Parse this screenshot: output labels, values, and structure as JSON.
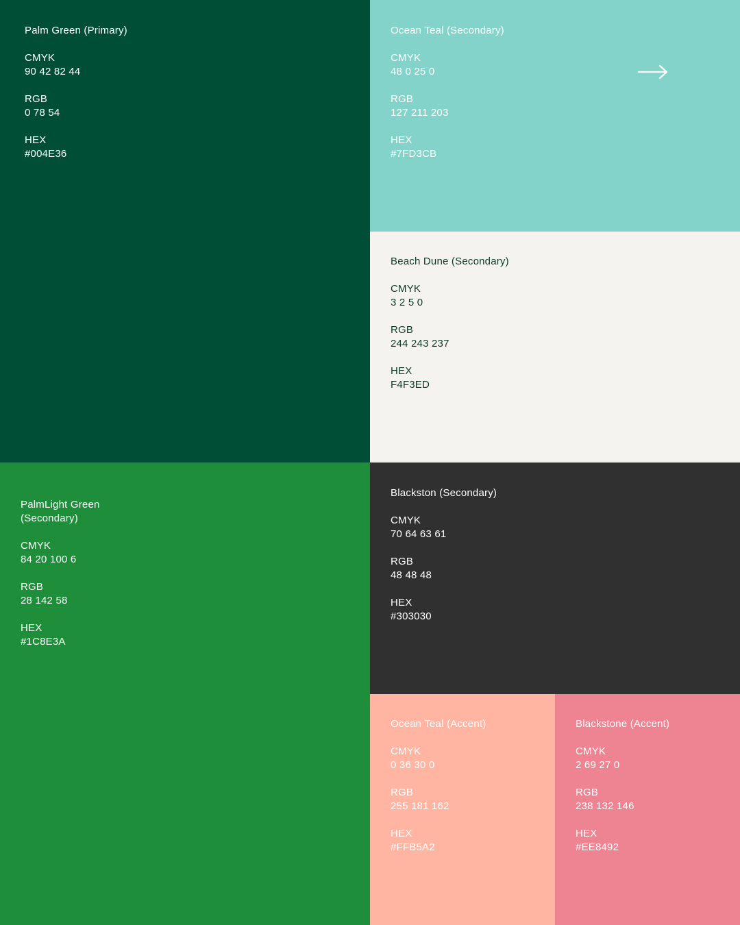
{
  "swatches": {
    "palm_green": {
      "title": "Palm Green (Primary)",
      "bg": "#004E36",
      "fg": "#FFFFFF",
      "cmyk_label": "CMYK",
      "cmyk": "90 42 82 44",
      "rgb_label": "RGB",
      "rgb": "0 78 54",
      "hex_label": "HEX",
      "hex": "#004E36"
    },
    "ocean_teal": {
      "title": "Ocean Teal (Secondary)",
      "bg": "#84D3CB",
      "fg": "#FFFFFF",
      "cmyk_label": "CMYK",
      "cmyk": "48 0 25 0",
      "rgb_label": "RGB",
      "rgb": "127 211 203",
      "hex_label": "HEX",
      "hex": "#7FD3CB"
    },
    "beach_dune": {
      "title": "Beach Dune (Secondary)",
      "bg": "#F4F3EF",
      "fg": "#0E3A24",
      "cmyk_label": "CMYK",
      "cmyk": "3 2 5 0",
      "rgb_label": "RGB",
      "rgb": "244 243 237",
      "hex_label": "HEX",
      "hex": "F4F3ED"
    },
    "palmlight_green": {
      "title": "PalmLight Green\n(Secondary)",
      "bg": "#1E8E3A",
      "fg": "#FFFFFF",
      "cmyk_label": "CMYK",
      "cmyk": "84 20 100 6",
      "rgb_label": "RGB",
      "rgb": "28 142 58",
      "hex_label": "HEX",
      "hex": "#1C8E3A"
    },
    "blackston": {
      "title": "Blackston (Secondary)",
      "bg": "#303030",
      "fg": "#FFFFFF",
      "cmyk_label": "CMYK",
      "cmyk": "70 64 63 61",
      "rgb_label": "RGB",
      "rgb": "48 48 48",
      "hex_label": "HEX",
      "hex": "#303030"
    },
    "ocean_teal_accent": {
      "title": "Ocean Teal (Accent)",
      "bg": "#FFB5A2",
      "fg": "#FFFFFF",
      "cmyk_label": "CMYK",
      "cmyk": "0 36 30 0",
      "rgb_label": "RGB",
      "rgb": "255 181 162",
      "hex_label": "HEX",
      "hex": "#FFB5A2"
    },
    "blackstone_accent": {
      "title": "Blackstone (Accent)",
      "bg": "#EE8492",
      "fg": "#FFFFFF",
      "cmyk_label": "CMYK",
      "cmyk": "2 69 27 0",
      "rgb_label": "RGB",
      "rgb": "238 132 146",
      "hex_label": "HEX",
      "hex": "#EE8492"
    }
  },
  "icons": {
    "next": "arrow-right-icon"
  }
}
